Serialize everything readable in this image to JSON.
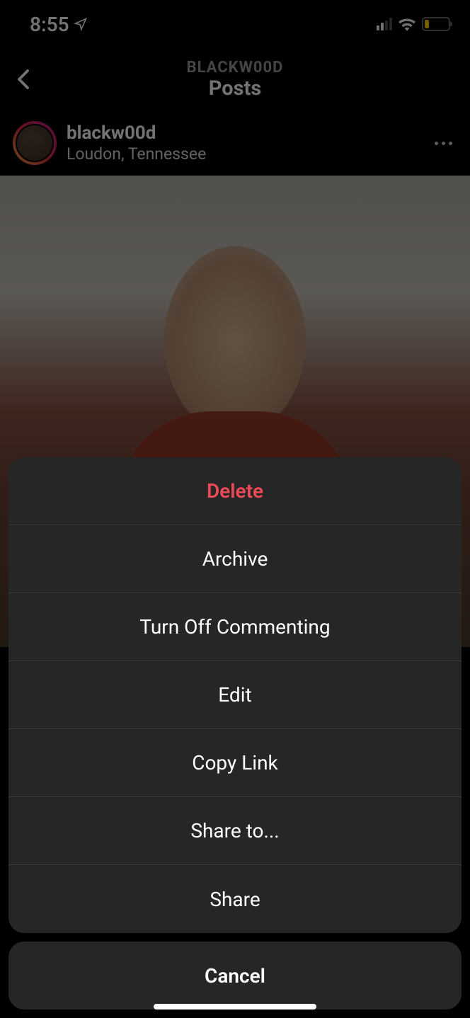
{
  "status_bar": {
    "time": "8:55"
  },
  "header": {
    "subtitle": "BLACKW00D",
    "title": "Posts"
  },
  "post": {
    "username": "blackw00d",
    "location": "Loudon, Tennessee"
  },
  "action_sheet": {
    "delete": "Delete",
    "archive": "Archive",
    "turn_off_commenting": "Turn Off Commenting",
    "edit": "Edit",
    "copy_link": "Copy Link",
    "share_to": "Share to...",
    "share": "Share",
    "cancel": "Cancel"
  }
}
